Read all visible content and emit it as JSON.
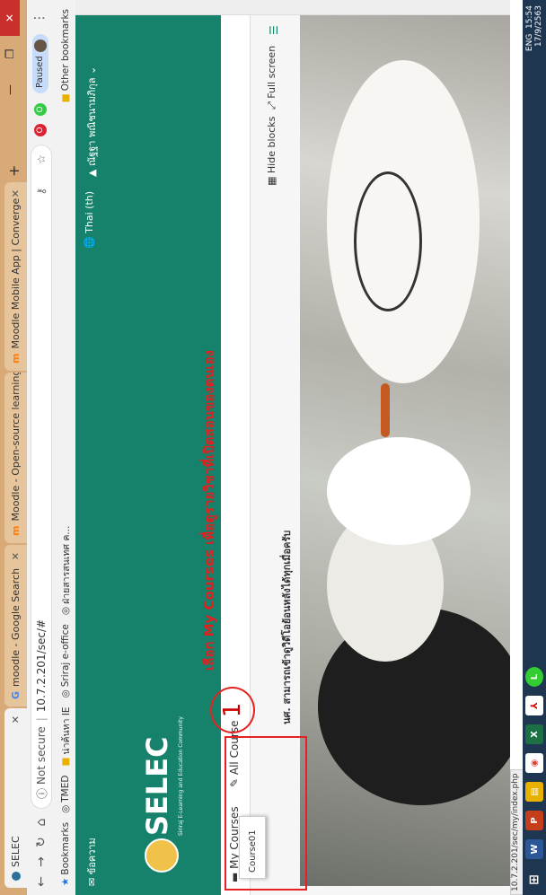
{
  "browser": {
    "tabs": [
      "SELEC",
      "moodle - Google Search",
      "Moodle - Open-source learning",
      "Moodle Mobile App | Converge"
    ],
    "address": {
      "security": "Not secure",
      "url": "10.7.2.201/sec/#"
    },
    "profile_status": "Paused",
    "bookmarks": [
      "Bookmarks",
      "TMED",
      "น่าค้นหา IE",
      "Sriraj e-office",
      "ฝ่ายสารสนเทศ ค..."
    ],
    "other_bookmarks": "Other bookmarks"
  },
  "site": {
    "top_left_label": "ข้อความ",
    "language": "Thai (th)",
    "user_name": "ณัฐฐา พณิชนามภิกุล",
    "logo_text": "SELEC",
    "logo_subtitle": "Siriraj E-Learning and Education Community",
    "menu": {
      "my_courses": "My Courses",
      "all_course": "All Course"
    },
    "dropdown_items": [
      "Course01"
    ],
    "hide_blocks": "Hide blocks",
    "full_screen": "Full screen",
    "notice": "นศ. สามารถเข้าดูวิดีโอย้อนหลังได้ทุกเมื่อครับ"
  },
  "annotation": {
    "step_number": "1",
    "text": "เลือก My Courses เพื่อดูรายวิชาที่เปิดสอนของตนเอง",
    "color": "#e52222"
  },
  "status_url": "10.7.2.201/sec/my/index.php",
  "system_tray": {
    "time": "15:54",
    "date": "17/9/2563",
    "lang": "ENG"
  },
  "taskbar_apps": [
    "windows-icon",
    "word-icon",
    "powerpoint-icon",
    "explorer-icon",
    "chrome-icon",
    "excel-icon",
    "acrobat-icon",
    "line-icon"
  ],
  "colors": {
    "theme_green": "#16826c",
    "chrome_tabbar": "#d8aa78",
    "taskbar": "#1e3650"
  }
}
